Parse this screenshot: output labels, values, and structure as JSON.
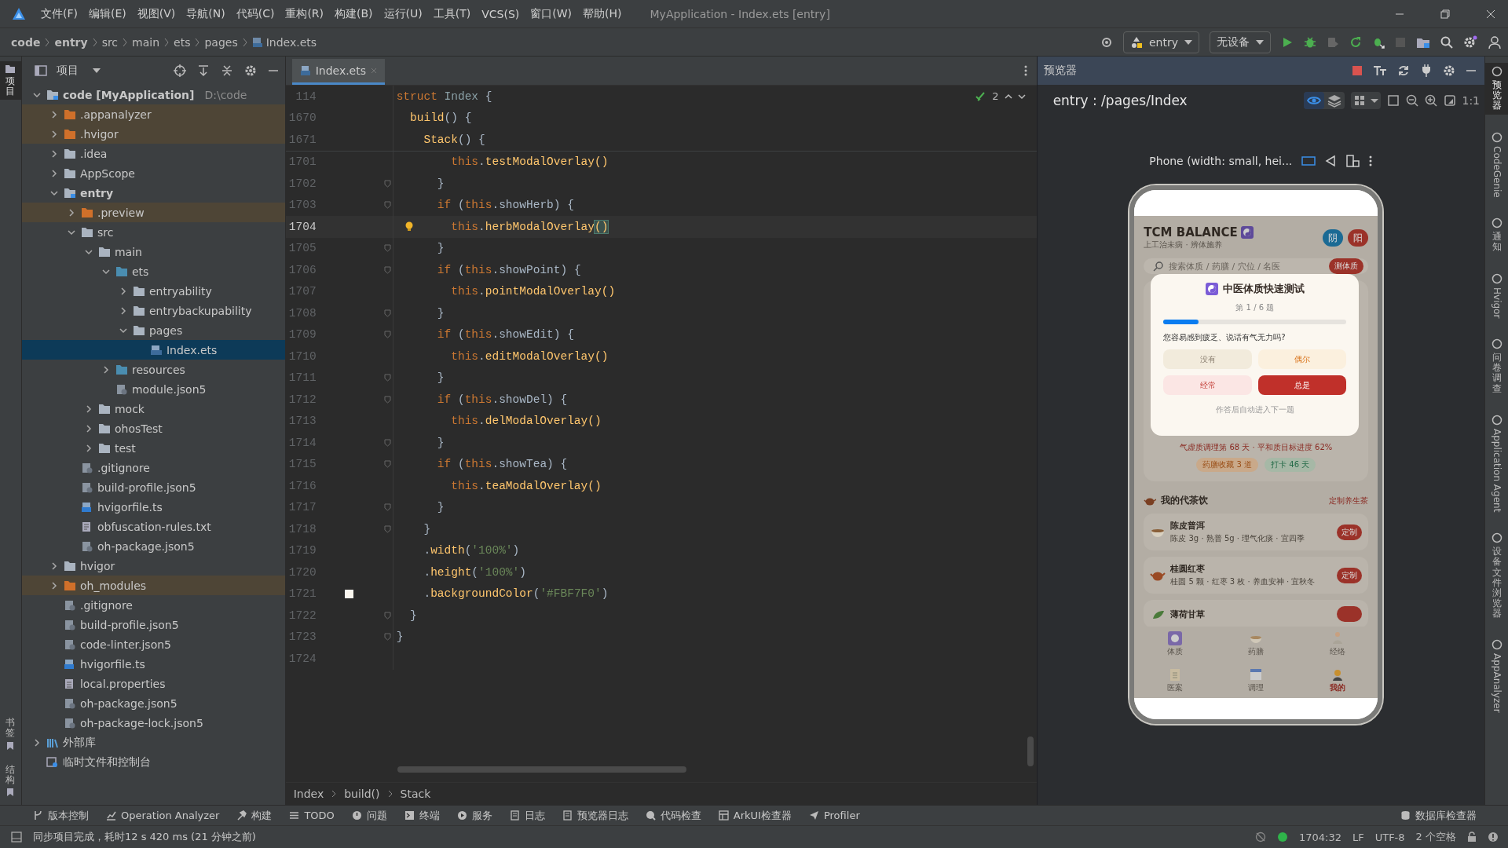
{
  "window": {
    "title": "MyApplication - Index.ets [entry]"
  },
  "menu": [
    "文件(F)",
    "编辑(E)",
    "视图(V)",
    "导航(N)",
    "代码(C)",
    "重构(R)",
    "构建(B)",
    "运行(U)",
    "工具(T)",
    "VCS(S)",
    "窗口(W)",
    "帮助(H)"
  ],
  "breadcrumb": [
    {
      "label": "code",
      "bold": true
    },
    {
      "label": "entry",
      "bold": true
    },
    {
      "label": "src",
      "bold": false
    },
    {
      "label": "main",
      "bold": false
    },
    {
      "label": "ets",
      "bold": false
    },
    {
      "label": "pages",
      "bold": false
    },
    {
      "label": "Index.ets",
      "bold": false
    }
  ],
  "run_config": {
    "module": "entry",
    "device": "无设备"
  },
  "left_strip": {
    "top": [
      {
        "label": "项目",
        "selected": true
      }
    ],
    "bottom": [
      {
        "label": "书签",
        "selected": false
      },
      {
        "label": "结构",
        "selected": false
      }
    ]
  },
  "project_panel": {
    "title": "项目"
  },
  "tree": [
    {
      "label": "code [MyApplication]",
      "detail": "D:\\code",
      "kind": "module",
      "expanded": true,
      "selected": false,
      "children": [
        {
          "label": ".appanalyzer",
          "kind": "excluded",
          "expanded": false,
          "selected": false
        },
        {
          "label": ".hvigor",
          "kind": "excluded",
          "expanded": false,
          "selected": false
        },
        {
          "label": ".idea",
          "kind": "folder",
          "expanded": false,
          "selected": false
        },
        {
          "label": "AppScope",
          "kind": "folder",
          "expanded": false,
          "selected": false
        },
        {
          "label": "entry",
          "kind": "module",
          "expanded": true,
          "selected": false,
          "children": [
            {
              "label": ".preview",
              "kind": "excluded",
              "expanded": false,
              "selected": false
            },
            {
              "label": "src",
              "kind": "folder",
              "expanded": true,
              "selected": false,
              "children": [
                {
                  "label": "main",
                  "kind": "folder",
                  "expanded": true,
                  "selected": false,
                  "children": [
                    {
                      "label": "ets",
                      "kind": "source",
                      "expanded": true,
                      "selected": false,
                      "children": [
                        {
                          "label": "entryability",
                          "kind": "folder",
                          "expanded": false,
                          "selected": false
                        },
                        {
                          "label": "entrybackupability",
                          "kind": "folder",
                          "expanded": false,
                          "selected": false
                        },
                        {
                          "label": "pages",
                          "kind": "folder",
                          "expanded": true,
                          "selected": false,
                          "children": [
                            {
                              "label": "Index.ets",
                              "kind": "ets",
                              "selected": true
                            }
                          ]
                        }
                      ]
                    },
                    {
                      "label": "resources",
                      "kind": "source",
                      "expanded": false,
                      "selected": false
                    },
                    {
                      "label": "module.json5",
                      "kind": "json",
                      "selected": false
                    }
                  ]
                },
                {
                  "label": "mock",
                  "kind": "folder",
                  "expanded": false,
                  "selected": false
                },
                {
                  "label": "ohosTest",
                  "kind": "folder",
                  "expanded": false,
                  "selected": false
                },
                {
                  "label": "test",
                  "kind": "folder",
                  "expanded": false,
                  "selected": false
                }
              ]
            },
            {
              "label": ".gitignore",
              "kind": "json",
              "selected": false
            },
            {
              "label": "build-profile.json5",
              "kind": "json",
              "selected": false
            },
            {
              "label": "hvigorfile.ts",
              "kind": "ts",
              "selected": false
            },
            {
              "label": "obfuscation-rules.txt",
              "kind": "text",
              "selected": false
            },
            {
              "label": "oh-package.json5",
              "kind": "json",
              "selected": false
            }
          ]
        },
        {
          "label": "hvigor",
          "kind": "folder",
          "expanded": false,
          "selected": false
        },
        {
          "label": "oh_modules",
          "kind": "excluded",
          "expanded": false,
          "selected": false
        },
        {
          "label": ".gitignore",
          "kind": "json",
          "selected": false
        },
        {
          "label": "build-profile.json5",
          "kind": "json",
          "selected": false
        },
        {
          "label": "code-linter.json5",
          "kind": "json",
          "selected": false
        },
        {
          "label": "hvigorfile.ts",
          "kind": "ts",
          "selected": false
        },
        {
          "label": "local.properties",
          "kind": "props",
          "selected": false
        },
        {
          "label": "oh-package.json5",
          "kind": "json",
          "selected": false
        },
        {
          "label": "oh-package-lock.json5",
          "kind": "json",
          "selected": false
        }
      ]
    },
    {
      "label": "外部库",
      "kind": "libraries",
      "expanded": false,
      "selected": false
    },
    {
      "label": "临时文件和控制台",
      "kind": "scratches",
      "selected": false
    }
  ],
  "editor": {
    "tab": "Index.ets",
    "problems": "2",
    "sticky": [
      {
        "num": "114",
        "tokens": [
          {
            "kind": "k",
            "text": "struct"
          },
          {
            "kind": "t",
            "text": " Index"
          },
          {
            "kind": "p",
            "text": " {"
          }
        ]
      },
      {
        "num": "1670",
        "tokens": [
          {
            "kind": "m",
            "text": "  build"
          },
          {
            "kind": "p",
            "text": "() {"
          }
        ]
      },
      {
        "num": "1671",
        "tokens": [
          {
            "kind": "m",
            "text": "    Stack"
          },
          {
            "kind": "p",
            "text": "() {"
          }
        ]
      }
    ],
    "lines": [
      {
        "num": "1701",
        "current": false,
        "kind": "plain",
        "tokens": [
          {
            "kind": "k",
            "text": "        this"
          },
          {
            "kind": "p",
            "text": "."
          },
          {
            "kind": "m",
            "text": "testModalOverlay()"
          }
        ]
      },
      {
        "num": "1702",
        "current": false,
        "kind": "fold",
        "tokens": [
          {
            "kind": "p",
            "text": "      }"
          }
        ]
      },
      {
        "num": "1703",
        "current": false,
        "kind": "fold",
        "tokens": [
          {
            "kind": "k",
            "text": "      if"
          },
          {
            "kind": "p",
            "text": " ("
          },
          {
            "kind": "k",
            "text": "this"
          },
          {
            "kind": "p",
            "text": ".showHerb) {"
          }
        ]
      },
      {
        "num": "1704",
        "current": true,
        "kind": "bulb",
        "tokens": [
          {
            "kind": "k",
            "text": "        this"
          },
          {
            "kind": "p",
            "text": "."
          },
          {
            "kind": "m",
            "text": "herbModalOverlay"
          },
          {
            "kind": "x",
            "text": "()"
          }
        ]
      },
      {
        "num": "1705",
        "current": false,
        "kind": "fold",
        "tokens": [
          {
            "kind": "p",
            "text": "      }"
          }
        ]
      },
      {
        "num": "1706",
        "current": false,
        "kind": "fold",
        "tokens": [
          {
            "kind": "k",
            "text": "      if"
          },
          {
            "kind": "p",
            "text": " ("
          },
          {
            "kind": "k",
            "text": "this"
          },
          {
            "kind": "p",
            "text": ".showPoint) {"
          }
        ]
      },
      {
        "num": "1707",
        "current": false,
        "kind": "plain",
        "tokens": [
          {
            "kind": "k",
            "text": "        this"
          },
          {
            "kind": "p",
            "text": "."
          },
          {
            "kind": "m",
            "text": "pointModalOverlay()"
          }
        ]
      },
      {
        "num": "1708",
        "current": false,
        "kind": "fold",
        "tokens": [
          {
            "kind": "p",
            "text": "      }"
          }
        ]
      },
      {
        "num": "1709",
        "current": false,
        "kind": "fold",
        "tokens": [
          {
            "kind": "k",
            "text": "      if"
          },
          {
            "kind": "p",
            "text": " ("
          },
          {
            "kind": "k",
            "text": "this"
          },
          {
            "kind": "p",
            "text": ".showEdit) {"
          }
        ]
      },
      {
        "num": "1710",
        "current": false,
        "kind": "plain",
        "tokens": [
          {
            "kind": "k",
            "text": "        this"
          },
          {
            "kind": "p",
            "text": "."
          },
          {
            "kind": "m",
            "text": "editModalOverlay()"
          }
        ]
      },
      {
        "num": "1711",
        "current": false,
        "kind": "fold",
        "tokens": [
          {
            "kind": "p",
            "text": "      }"
          }
        ]
      },
      {
        "num": "1712",
        "current": false,
        "kind": "fold",
        "tokens": [
          {
            "kind": "k",
            "text": "      if"
          },
          {
            "kind": "p",
            "text": " ("
          },
          {
            "kind": "k",
            "text": "this"
          },
          {
            "kind": "p",
            "text": ".showDel) {"
          }
        ]
      },
      {
        "num": "1713",
        "current": false,
        "kind": "plain",
        "tokens": [
          {
            "kind": "k",
            "text": "        this"
          },
          {
            "kind": "p",
            "text": "."
          },
          {
            "kind": "m",
            "text": "delModalOverlay()"
          }
        ]
      },
      {
        "num": "1714",
        "current": false,
        "kind": "fold",
        "tokens": [
          {
            "kind": "p",
            "text": "      }"
          }
        ]
      },
      {
        "num": "1715",
        "current": false,
        "kind": "fold",
        "tokens": [
          {
            "kind": "k",
            "text": "      if"
          },
          {
            "kind": "p",
            "text": " ("
          },
          {
            "kind": "k",
            "text": "this"
          },
          {
            "kind": "p",
            "text": ".showTea) {"
          }
        ]
      },
      {
        "num": "1716",
        "current": false,
        "kind": "plain",
        "tokens": [
          {
            "kind": "k",
            "text": "        this"
          },
          {
            "kind": "p",
            "text": "."
          },
          {
            "kind": "m",
            "text": "teaModalOverlay()"
          }
        ]
      },
      {
        "num": "1717",
        "current": false,
        "kind": "fold",
        "tokens": [
          {
            "kind": "p",
            "text": "      }"
          }
        ]
      },
      {
        "num": "1718",
        "current": false,
        "kind": "fold",
        "tokens": [
          {
            "kind": "p",
            "text": "    }"
          }
        ]
      },
      {
        "num": "1719",
        "current": false,
        "kind": "plain",
        "tokens": [
          {
            "kind": "p",
            "text": "    ."
          },
          {
            "kind": "m",
            "text": "width"
          },
          {
            "kind": "p",
            "text": "("
          },
          {
            "kind": "s",
            "text": "'100%'"
          },
          {
            "kind": "p",
            "text": ")"
          }
        ]
      },
      {
        "num": "1720",
        "current": false,
        "kind": "plain",
        "tokens": [
          {
            "kind": "p",
            "text": "    ."
          },
          {
            "kind": "m",
            "text": "height"
          },
          {
            "kind": "p",
            "text": "("
          },
          {
            "kind": "s",
            "text": "'100%'"
          },
          {
            "kind": "p",
            "text": ")"
          }
        ]
      },
      {
        "num": "1721",
        "current": false,
        "kind": "swatch",
        "tokens": [
          {
            "kind": "p",
            "text": "    ."
          },
          {
            "kind": "m",
            "text": "backgroundColor"
          },
          {
            "kind": "p",
            "text": "("
          },
          {
            "kind": "s",
            "text": "'#FBF7F0'"
          },
          {
            "kind": "p",
            "text": ")"
          }
        ]
      },
      {
        "num": "1722",
        "current": false,
        "kind": "fold",
        "tokens": [
          {
            "kind": "p",
            "text": "  }"
          }
        ]
      },
      {
        "num": "1723",
        "current": false,
        "kind": "fold",
        "tokens": [
          {
            "kind": "p",
            "text": "}"
          }
        ]
      },
      {
        "num": "1724",
        "current": false,
        "kind": "plain"
      }
    ],
    "path": [
      "Index",
      "build()",
      "Stack"
    ]
  },
  "preview": {
    "title": "预览器",
    "route": "entry : /pages/Index",
    "zoom_label": "1:1",
    "device": "Phone (width: small, hei...",
    "app": {
      "title": "TCM BALANCE",
      "subtitle": "上工治未病 · 辨体施养",
      "badges": [
        {
          "label": "阴",
          "color": "#1b6a94"
        },
        {
          "label": "阳",
          "color": "#9b3229"
        }
      ],
      "search_placeholder": "搜索体质 / 药膳 / 穴位 / 名医",
      "search_button": "测体质",
      "stats": "气虚质调理第 68 天 · 平和质目标进度 62%",
      "chips": [
        {
          "label": "药膳收藏 3 道",
          "kind": "food"
        },
        {
          "label": "打卡 46 天",
          "kind": "streak"
        }
      ],
      "section": {
        "title": "我的代茶饮",
        "link": "定制养生茶"
      },
      "teas": [
        {
          "name": "陈皮普洱",
          "detail": "陈皮 3g · 熟普 5g · 理气化痰 · 宜四季",
          "button": "定制"
        },
        {
          "name": "桂圆红枣",
          "detail": "桂圆 5 颗 · 红枣 3 枚 · 养血安神 · 宜秋冬",
          "button": "定制"
        },
        {
          "name": "薄荷甘草"
        }
      ],
      "tabs": [
        {
          "label": "体质",
          "selected": false
        },
        {
          "label": "药膳",
          "selected": false
        },
        {
          "label": "经络",
          "selected": false
        },
        {
          "label": "医案",
          "selected": false
        },
        {
          "label": "调理",
          "selected": false
        },
        {
          "label": "我的",
          "selected": true
        }
      ]
    },
    "modal": {
      "title": "中医体质快速测试",
      "step": "第 1 / 6 题",
      "level": 0.19,
      "question": "您容易感到疲乏、说话有气无力吗?",
      "options": [
        {
          "label": "没有",
          "kind": "plain",
          "selected": false
        },
        {
          "label": "偶尔",
          "kind": "mild",
          "selected": false
        },
        {
          "label": "经常",
          "kind": "warn",
          "selected": false
        },
        {
          "label": "总是",
          "kind": "warn",
          "selected": true
        }
      ],
      "hint": "作答后自动进入下一题"
    }
  },
  "right_strip": [
    {
      "label": "预览器",
      "kind": "cjk",
      "selected": true
    },
    {
      "label": "CodeGenie",
      "kind": "latin",
      "selected": false
    },
    {
      "label": "通知",
      "kind": "cjk",
      "selected": false
    },
    {
      "label": "Hvigor",
      "kind": "latin",
      "selected": false
    },
    {
      "label": "问卷调查",
      "kind": "cjk",
      "selected": false
    },
    {
      "label": "Application Agent",
      "kind": "latin",
      "selected": false
    },
    {
      "label": "设备文件浏览器",
      "kind": "cjk",
      "selected": false
    },
    {
      "label": "AppAnalyzer",
      "kind": "latin",
      "selected": false
    }
  ],
  "tool_windows": [
    "版本控制",
    "Operation Analyzer",
    "构建",
    "TODO",
    "问题",
    "终端",
    "服务",
    "日志",
    "预览器日志",
    "代码检查",
    "ArkUI检查器",
    "Profiler"
  ],
  "tool_windows_right": "数据库检查器",
  "status_bar": {
    "message": "同步项目完成，耗时12 s 420 ms (21 分钟之前)",
    "position": "1704:32",
    "line_ending": "LF",
    "encoding": "UTF-8",
    "indent": "2 个空格"
  }
}
